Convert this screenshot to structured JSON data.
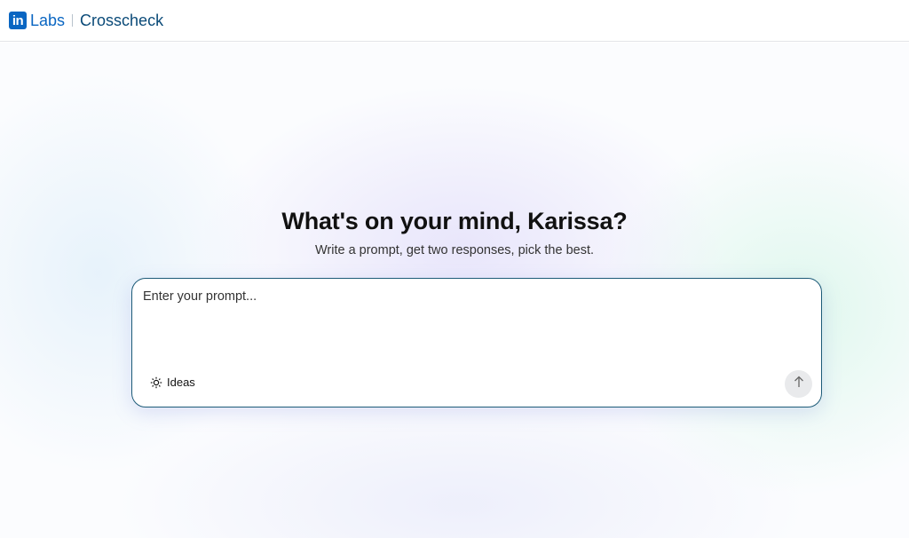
{
  "header": {
    "logo_in": "in",
    "logo_labs": "Labs",
    "product_name": "Crosscheck"
  },
  "hero": {
    "title": "What's on your mind, Karissa?",
    "subtitle": "Write a prompt, get two responses, pick the best."
  },
  "prompt": {
    "placeholder": "Enter your prompt...",
    "value": "",
    "ideas_label": "Ideas",
    "ideas_icon": "lightbulb-icon",
    "send_icon": "arrow-up-icon"
  },
  "colors": {
    "brand_blue": "#0a66c2",
    "product_text": "#0a4a78",
    "prompt_border": "#1d5b78",
    "send_button_bg": "#e9eaec"
  }
}
